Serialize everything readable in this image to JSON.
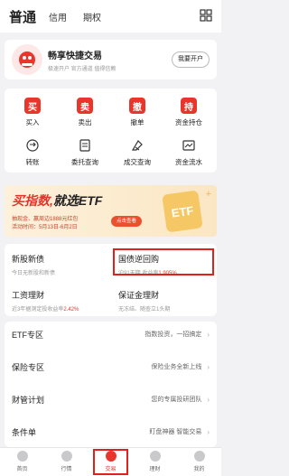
{
  "header": {
    "tabs": [
      "普通",
      "信用",
      "期权"
    ],
    "menu_icon": "grid-icon"
  },
  "open_account": {
    "title": "畅享快捷交易",
    "subtitle": "极速开户  官方通道  值得信赖",
    "button": "我要开户"
  },
  "quick_actions": [
    {
      "label": "买入",
      "glyph": "买",
      "icon": "buy-icon"
    },
    {
      "label": "卖出",
      "glyph": "卖",
      "icon": "sell-icon"
    },
    {
      "label": "撤单",
      "glyph": "撤",
      "icon": "cancel-order-icon"
    },
    {
      "label": "资金持仓",
      "glyph": "持",
      "icon": "holdings-icon"
    },
    {
      "label": "转账",
      "icon": "transfer-icon"
    },
    {
      "label": "委托查询",
      "icon": "order-query-icon"
    },
    {
      "label": "成交查询",
      "icon": "trade-query-icon"
    },
    {
      "label": "资金流水",
      "icon": "fund-flow-icon"
    }
  ],
  "ad": {
    "headline_a": "买指数,",
    "headline_b": "就选",
    "headline_c": "ETF",
    "line1": "抽现金、赢周边1888元红包",
    "line2": "活动时间：5月13日-6月2日",
    "button": "点击查看"
  },
  "products": [
    {
      "title": "新股新债",
      "desc": "今日无新股和新债"
    },
    {
      "title": "国债逆回购",
      "desc_prefix": "沪91天期 收益率",
      "desc_rate": "1.905%"
    },
    {
      "title": "工资理财",
      "desc_prefix": "近3年据测定投收益率",
      "desc_rate": "2.42%"
    },
    {
      "title": "保证金理财",
      "desc": "无冻结、随查立1头期"
    }
  ],
  "menu_rows": [
    {
      "name": "ETF专区",
      "desc": "指数投资，一招搞定"
    },
    {
      "name": "保险专区",
      "desc": "保险业务全新上线"
    },
    {
      "name": "财管计划",
      "desc": "您的专属投研团队"
    },
    {
      "name": "条件单",
      "desc": "盯盘神器 智能交易"
    }
  ],
  "bottom_nav": [
    {
      "label": "首页",
      "icon": "home-icon"
    },
    {
      "label": "行情",
      "icon": "market-icon"
    },
    {
      "label": "交易",
      "icon": "trade-icon",
      "active": true
    },
    {
      "label": "理财",
      "icon": "wealth-icon"
    },
    {
      "label": "我的",
      "icon": "profile-icon"
    }
  ]
}
